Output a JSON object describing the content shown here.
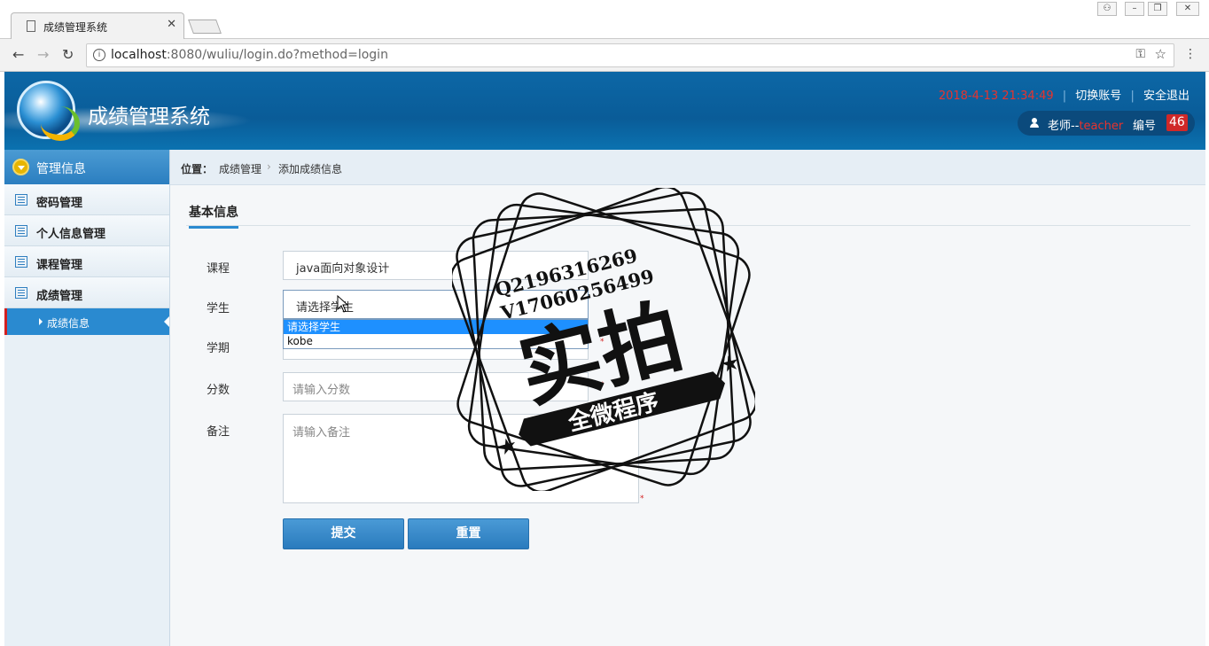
{
  "browser": {
    "tab_title": "成绩管理系统",
    "url_host": "localhost",
    "url_rest": ":8080/wuliu/login.do?method=login"
  },
  "header": {
    "app_title": "成绩管理系统",
    "datetime": "2018-4-13 21:34:49",
    "switch_account": "切换账号",
    "logout": "安全退出",
    "user_prefix": "老师--",
    "user_role": "teacher",
    "id_label": "编号",
    "id_value": "46"
  },
  "sidebar": {
    "title": "管理信息",
    "items": [
      {
        "label": "密码管理"
      },
      {
        "label": "个人信息管理"
      },
      {
        "label": "课程管理"
      },
      {
        "label": "成绩管理"
      }
    ],
    "active_sub": "成绩信息"
  },
  "breadcrumb": {
    "label": "位置：",
    "level1": "成绩管理",
    "level2": "添加成绩信息"
  },
  "section_title": "基本信息",
  "form": {
    "course_label": "课程",
    "course_value": "java面向对象设计",
    "student_label": "学生",
    "student_value": "请选择学生",
    "student_options": [
      "请选择学生",
      "kobe"
    ],
    "term_label": "学期",
    "score_label": "分数",
    "score_placeholder": "请输入分数",
    "note_label": "备注",
    "note_placeholder": "请输入备注",
    "submit_label": "提交",
    "reset_label": "重置"
  },
  "watermark": {
    "line1": "Q2196316269",
    "line2": "V17060256499",
    "main": "实拍",
    "banner": "全微程序"
  },
  "colors": {
    "header_bg": "#0a5c98",
    "accent": "#2a8ad0",
    "date_red": "#e8332d"
  }
}
